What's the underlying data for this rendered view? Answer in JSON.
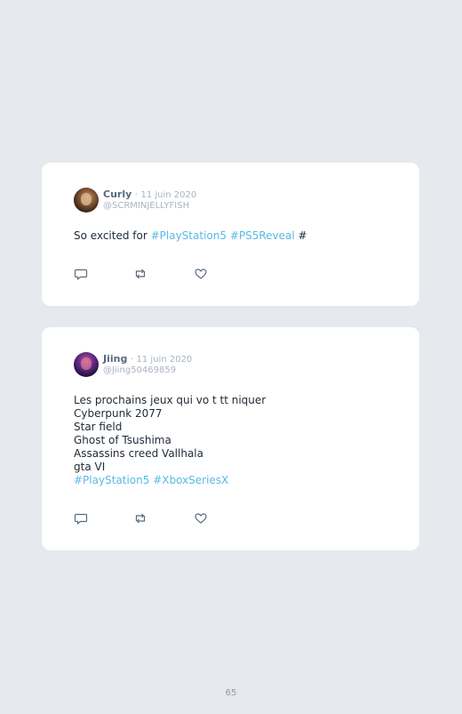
{
  "tweets": [
    {
      "name": "Curly",
      "separator": "·",
      "date": "11 juin 2020",
      "handle": "@SCRMINJELLYFISH",
      "text_plain": "So excited for ",
      "hashtag_1": "#PlayStation5",
      "space": " ",
      "hashtag_2": "#PS5Reveal",
      "trailing": " #"
    },
    {
      "name": "Jiing",
      "separator": "·",
      "date": "11 juin 2020",
      "handle": "@Jiing50469859",
      "lines": [
        "Les prochains jeux qui vo t tt niquer",
        "Cyberpunk 2077",
        "Star field",
        "Ghost of Tsushima",
        "Assassins creed Vallhala",
        "gta VI"
      ],
      "hashtags_line": "#PlayStation5 #XboxSeriesX"
    }
  ],
  "actions": {
    "reply_icon": "comment-bubble",
    "retweet_icon": "retweet-arrows",
    "like_icon": "heart-outline"
  },
  "colors": {
    "page_background": "#e6e9ed",
    "card_background": "#ffffff",
    "hashtag": "#5bb8e4",
    "muted": "#a9b4bf",
    "name": "#5a6b7d",
    "icon": "#5a6b7d"
  },
  "page_number": "65"
}
